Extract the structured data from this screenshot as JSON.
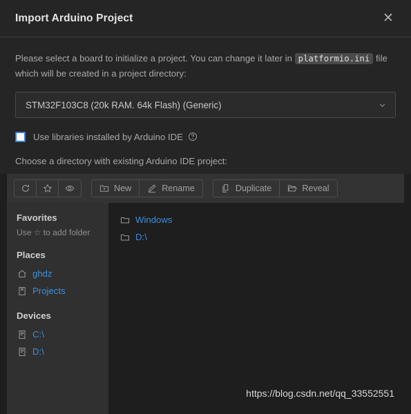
{
  "dialog": {
    "title": "Import Arduino Project",
    "close_label": "✕"
  },
  "description": {
    "line1_before": "Please select a board to initialize a project. You can change it later in ",
    "code_chip": "platformio.ini",
    "line2": " file which will be created in a project directory:"
  },
  "board_select": {
    "value": "STM32F103C8 (20k RAM. 64k Flash) (Generic)",
    "icon": "chevron-down-icon"
  },
  "arduino_libs_checkbox": {
    "checked": false,
    "label": "Use libraries installed by Arduino IDE",
    "help_icon": "help-circle-icon"
  },
  "directory_label": "Choose a directory with existing Arduino IDE project:",
  "toolbar": {
    "icon_buttons": [
      {
        "name": "refresh-button",
        "icon": "refresh-icon"
      },
      {
        "name": "favorite-button",
        "icon": "star-icon"
      },
      {
        "name": "show-hidden-button",
        "icon": "eye-icon"
      }
    ],
    "text_buttons": [
      {
        "name": "new-button",
        "label": "New",
        "icon": "folder-plus-icon"
      },
      {
        "name": "rename-button",
        "label": "Rename",
        "icon": "pencil-icon"
      },
      {
        "name": "duplicate-button",
        "label": "Duplicate",
        "icon": "copy-icon"
      },
      {
        "name": "reveal-button",
        "label": "Reveal",
        "icon": "folder-open-icon"
      }
    ]
  },
  "sidebar": {
    "favorites_title": "Favorites",
    "favorites_hint_before": "Use ",
    "favorites_hint_star": "☆",
    "favorites_hint_after": " to add folder",
    "places_title": "Places",
    "places": [
      {
        "label": "ghdz",
        "icon": "home-icon"
      },
      {
        "label": "Projects",
        "icon": "book-icon"
      }
    ],
    "devices_title": "Devices",
    "devices": [
      {
        "label": "C:\\",
        "icon": "drive-icon"
      },
      {
        "label": "D:\\",
        "icon": "drive-icon"
      }
    ]
  },
  "filelist": {
    "items": [
      {
        "label": "Windows",
        "icon": "folder-icon"
      },
      {
        "label": "D:\\",
        "icon": "folder-icon"
      }
    ]
  },
  "watermark": "https://blog.csdn.net/qq_33552551",
  "colors": {
    "dialog_bg": "#252526",
    "panel_bg": "#1e1e1e",
    "sidebar_bg": "#303030",
    "toolbar_bg": "#333333",
    "link_blue": "#3b8ee0",
    "accent_blue": "#3b7fd4",
    "text": "#cccccc",
    "muted_text": "#a8a8a8"
  }
}
